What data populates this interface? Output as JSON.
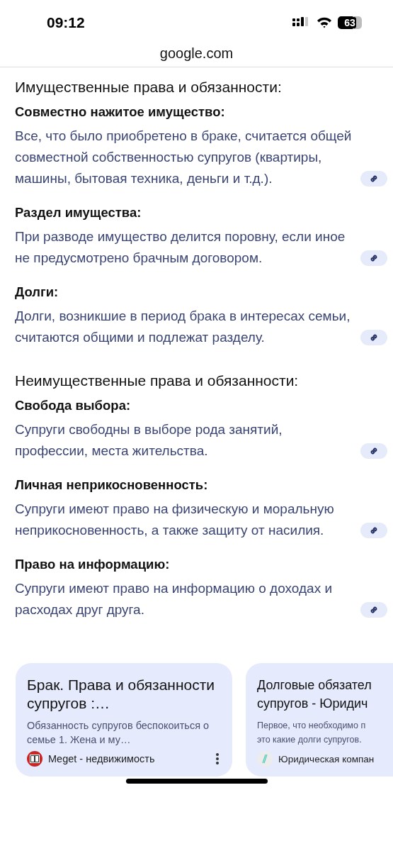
{
  "status_bar": {
    "time": "09:12",
    "battery": "63"
  },
  "address_bar": {
    "url": "google.com"
  },
  "sections": [
    {
      "heading": "Имущественные права и обязанности:",
      "items": [
        {
          "title": "Совместно нажитое имущество:",
          "text": "Все, что было приобретено в браке, считается общей совместной собственностью супругов (квартиры, машины, бытовая техника, деньги и т.д.)."
        },
        {
          "title": "Раздел имущества:",
          "text": "При разводе имущество делится поровну, если иное не предусмотрено брачным договором."
        },
        {
          "title": "Долги:",
          "text": "Долги, возникшие в период брака в интересах семьи, считаются общими и подлежат разделу."
        }
      ]
    },
    {
      "heading": "Неимущественные права и обязанности:",
      "items": [
        {
          "title": "Свобода выбора:",
          "text": "Супруги свободны в выборе рода занятий, профессии, места жительства."
        },
        {
          "title": "Личная неприкосновенность:",
          "text": "Супруги имеют право на физическую и моральную неприкосновенность, а также защиту от насилия."
        },
        {
          "title": "Право на информацию:",
          "text": "Супруги имеют право на информацию о доходах и расходах друг друга."
        }
      ]
    }
  ],
  "cards": [
    {
      "title": "Брак. Права и обязанности супругов :…",
      "snippet": "Обязанность супругов беспокоиться о семье 1. Жена и му…",
      "source": "Meget - недвижимость",
      "kind": "full"
    },
    {
      "title_lines": [
        "Долговые обязател",
        "супругов - Юридич"
      ],
      "snippet_lines": [
        "Первое, что необходимо п",
        "это какие долги супругов."
      ],
      "source": "Юридическая компан",
      "kind": "cut"
    }
  ]
}
